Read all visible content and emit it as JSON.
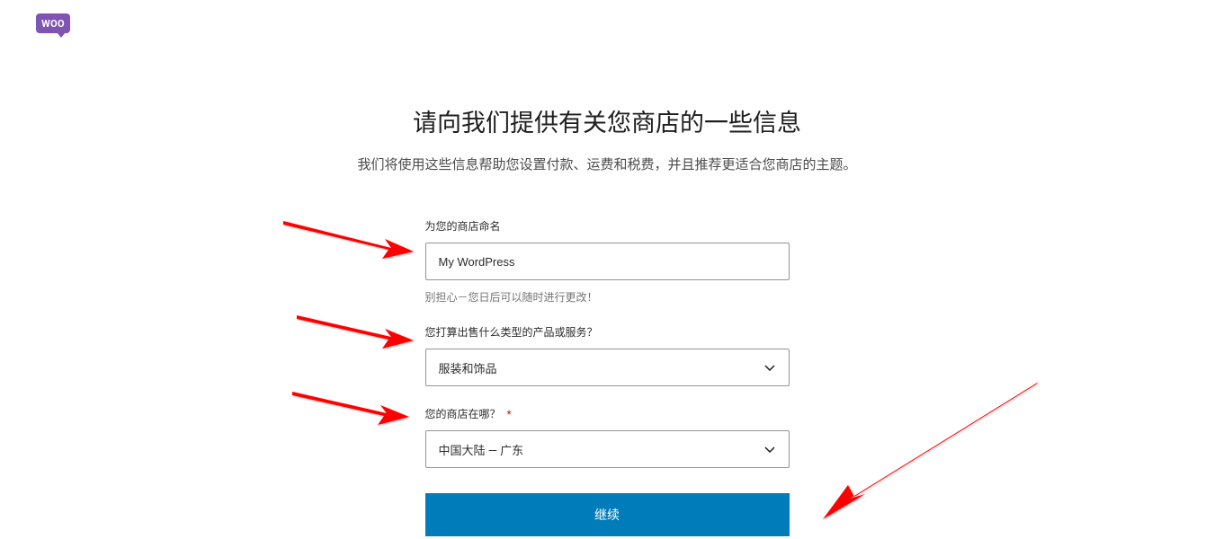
{
  "logo": {
    "text": "WOO"
  },
  "header": {
    "title": "请向我们提供有关您商店的一些信息",
    "subtitle": "我们将使用这些信息帮助您设置付款、运费和税费，并且推荐更适合您商店的主题。"
  },
  "form": {
    "storeName": {
      "label": "为您的商店命名",
      "value": "My WordPress",
      "hint": "别担心－您日后可以随时进行更改！"
    },
    "productType": {
      "label": "您打算出售什么类型的产品或服务？",
      "value": "服装和饰品"
    },
    "storeLocation": {
      "label": "您的商店在哪？",
      "required": "*",
      "value": "中国大陆 — 广东"
    },
    "continueButton": "继续"
  }
}
